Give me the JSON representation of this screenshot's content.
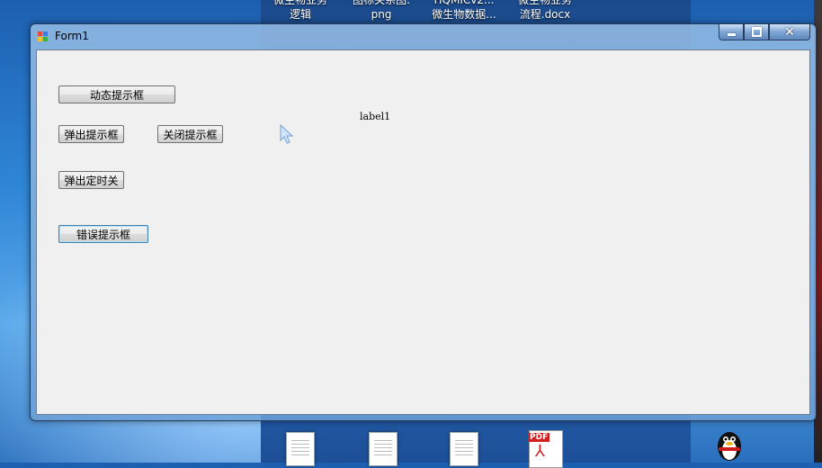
{
  "desktop": {
    "icons": [
      {
        "line1": "微生物业务",
        "line2": "逻辑"
      },
      {
        "line1": "图标关系图.",
        "line2": "png"
      },
      {
        "line1": "HQMICv2...",
        "line2": "微生物数据..."
      },
      {
        "line1": "微生物业务",
        "line2": "流程.docx"
      }
    ],
    "pdf_tag": "PDF"
  },
  "window": {
    "title": "Form1",
    "controls": {
      "minimize": "minimize",
      "maximize": "maximize",
      "close": "✕"
    }
  },
  "form": {
    "btn_dynamic_tip": "动态提示框",
    "btn_popup_tip": "弹出提示框",
    "btn_close_tip": "关闭提示框",
    "btn_popup_timed_close": "弹出定时关",
    "btn_error_tip": "错误提示框",
    "label1": "label1"
  }
}
